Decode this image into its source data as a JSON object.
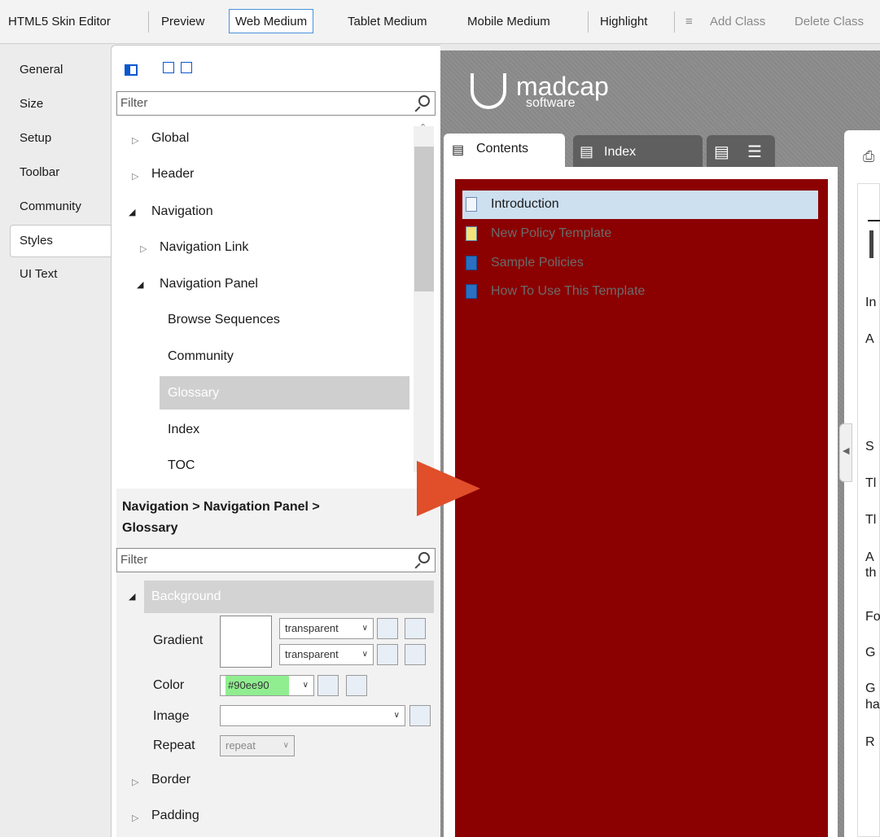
{
  "toolbar": {
    "title": "HTML5 Skin Editor",
    "preview": "Preview",
    "web_medium": "Web Medium",
    "tablet_medium": "Tablet Medium",
    "mobile_medium": "Mobile Medium",
    "highlight": "Highlight",
    "add_class": "Add Class",
    "delete_class": "Delete Class"
  },
  "leftnav": [
    "General",
    "Size",
    "Setup",
    "Toolbar",
    "Community",
    "Styles",
    "UI Text"
  ],
  "tree": {
    "filter_placeholder": "Filter",
    "global": "Global",
    "header": "Header",
    "navigation": "Navigation",
    "navigation_link": "Navigation Link",
    "navigation_panel": "Navigation Panel",
    "browse_sequences": "Browse Sequences",
    "community": "Community",
    "glossary": "Glossary",
    "index": "Index",
    "toc": "TOC"
  },
  "breadcrumb": {
    "line1": "Navigation > Navigation Panel >",
    "line2": "Glossary"
  },
  "props": {
    "filter_placeholder": "Filter",
    "background": "Background",
    "gradient": "Gradient",
    "gradient_top": "transparent",
    "gradient_bottom": "transparent",
    "color": "Color",
    "color_value": "#90ee90",
    "image": "Image",
    "repeat": "Repeat",
    "repeat_value": "repeat",
    "border": "Border",
    "padding": "Padding"
  },
  "preview": {
    "logo_main": "madcap",
    "logo_sub": "software",
    "tab_contents": "Contents",
    "tab_index": "Index",
    "toc": [
      "Introduction",
      "New Policy Template",
      "Sample Policies",
      "How To Use This Template"
    ],
    "topic_letters": [
      "In",
      "A",
      "S",
      "Tl",
      "Tl",
      "A",
      "th",
      "Fo",
      "G",
      "G",
      "ha",
      "R"
    ]
  },
  "colors": {
    "nav_background": "#8b0000",
    "accent": "#e04e2a",
    "selection": "#cde0f0"
  }
}
